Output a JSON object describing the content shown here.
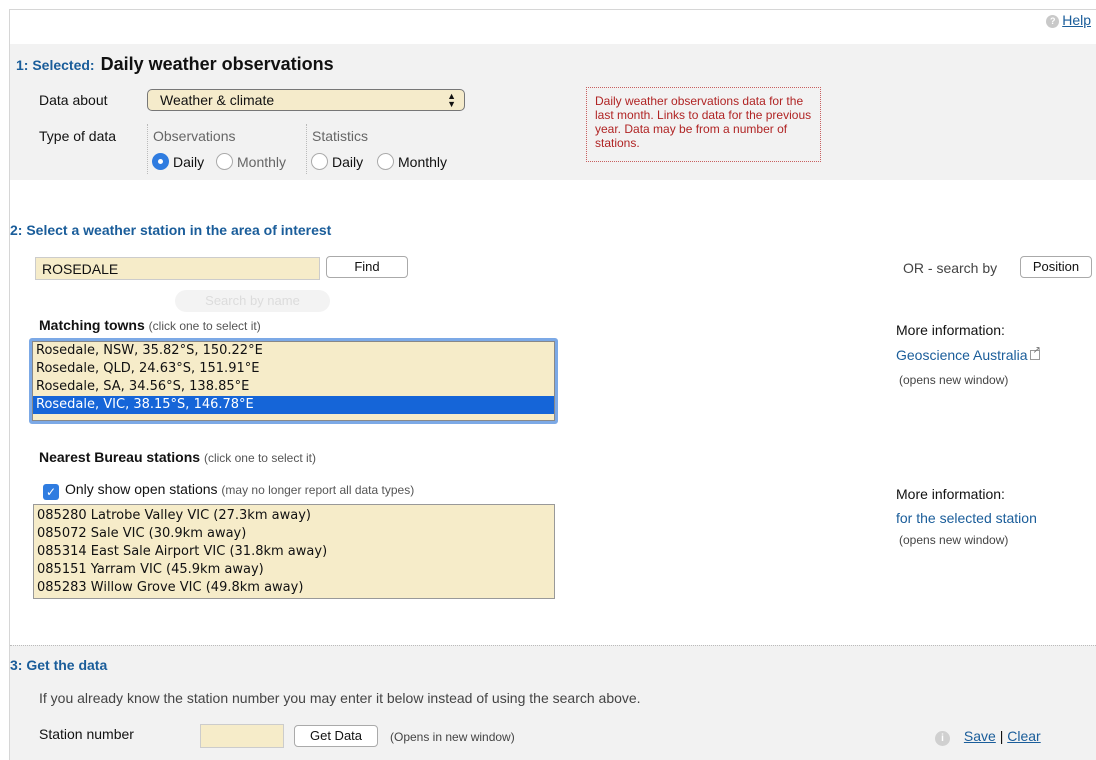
{
  "help": {
    "label": "Help"
  },
  "section1": {
    "number": "1: Selected:",
    "title": "Daily weather observations",
    "data_about_label": "Data about",
    "data_about_value": "Weather & climate",
    "type_label": "Type of data",
    "observations_label": "Observations",
    "statistics_label": "Statistics",
    "obs_daily": "Daily",
    "obs_monthly": "Monthly",
    "stat_daily": "Daily",
    "stat_monthly": "Monthly",
    "note": "Daily weather observations data for the last month. Links to data for the previous year. Data may be from a number of stations."
  },
  "section2": {
    "title": "2:  Select a weather station in the area of interest",
    "search_value": "ROSEDALE",
    "find_label": "Find",
    "search_tooltip": "Search by name",
    "or_label": "OR - search by",
    "position_label": "Position",
    "towns_label": "Matching towns",
    "towns_hint": "(click one to select it)",
    "towns": [
      "Rosedale, NSW, 35.82°S, 150.22°E",
      "Rosedale, QLD, 24.63°S, 151.91°E",
      "Rosedale, SA, 34.56°S, 138.85°E",
      "Rosedale, VIC, 38.15°S, 146.78°E"
    ],
    "more_info_label": "More information:",
    "geoscience_link": "Geoscience Australia",
    "opens_new_window": "(opens new window)",
    "stations_label": "Nearest Bureau stations",
    "stations_hint": "(click one to select it)",
    "open_only_label": "Only show open stations",
    "open_only_hint": "(may no longer report all data types)",
    "stations": [
      "085280 Latrobe Valley VIC (27.3km away)",
      "085072 Sale VIC (30.9km away)",
      "085314 East Sale Airport VIC (31.8km away)",
      "085151 Yarram VIC (45.9km away)",
      "085283 Willow Grove VIC (49.8km away)"
    ],
    "more_info_label2": "More information:",
    "selected_station_link": "for the selected station",
    "opens_new_window2": "(opens new window)"
  },
  "section3": {
    "title": "3:  Get the data",
    "instructions": "If you already know the station number you may enter it below instead of using the search above.",
    "station_label": "Station number",
    "station_value": "",
    "get_data_label": "Get Data",
    "opens_label": "(Opens in new window)",
    "save_label": "Save",
    "separator": "|",
    "clear_label": "Clear"
  }
}
